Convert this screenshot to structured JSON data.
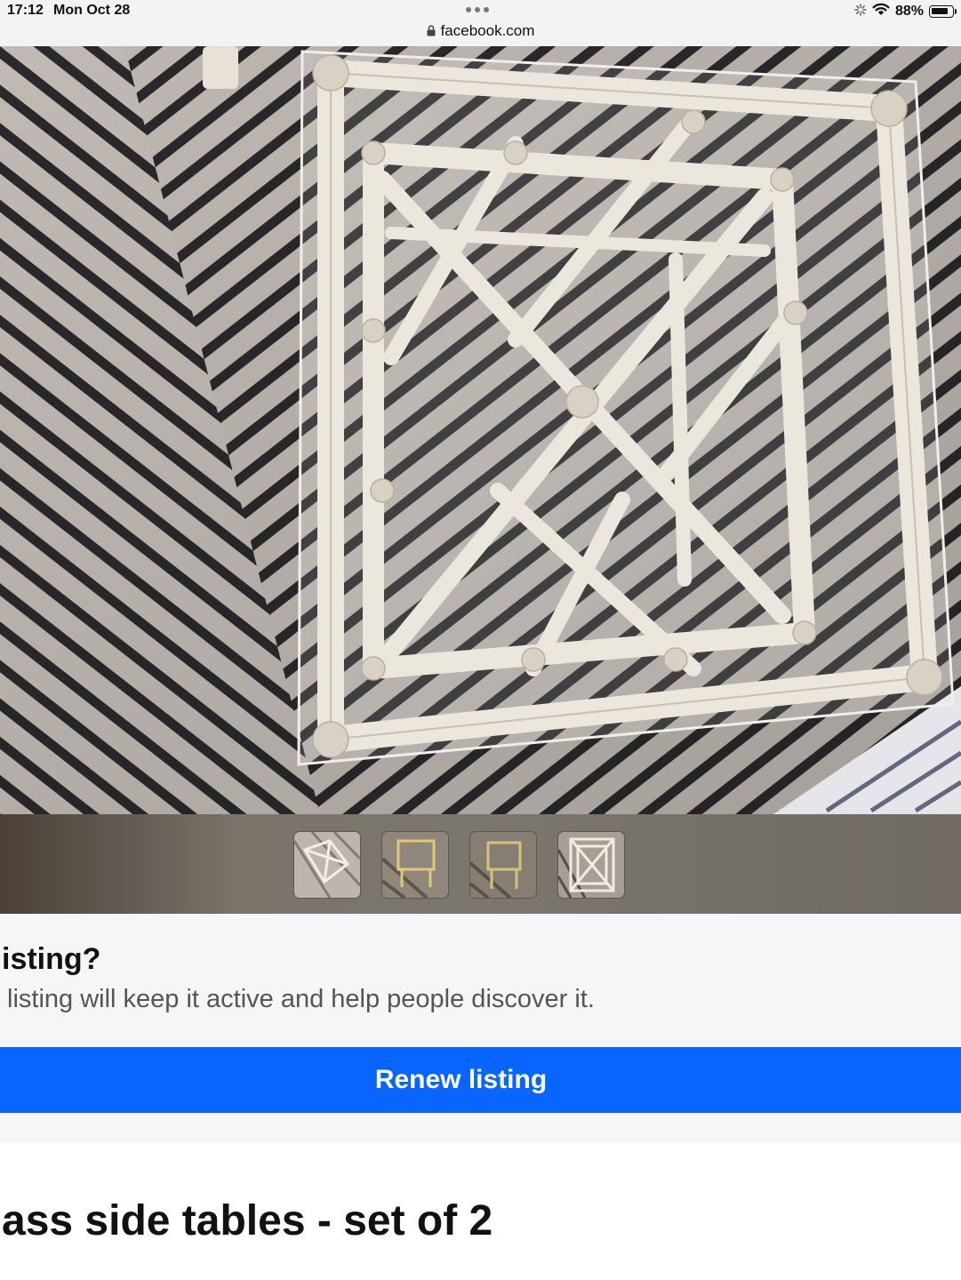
{
  "status_bar": {
    "time": "17:12",
    "date": "Mon Oct 28",
    "url": "facebook.com",
    "battery": "88%",
    "battery_level": 0.88,
    "icons": [
      "lock-icon",
      "activity-spinner-icon",
      "wifi-icon",
      "battery-icon"
    ]
  },
  "gallery": {
    "thumbnail_count": 4,
    "thumbnails": [
      "thumbnail-1",
      "thumbnail-2",
      "thumbnail-3",
      "thumbnail-4"
    ]
  },
  "renew": {
    "heading": "isting?",
    "description": " listing will keep it active and help people discover it.",
    "button_label": "Renew listing"
  },
  "listing": {
    "title": "ass side tables - set of 2"
  },
  "colors": {
    "primary_button": "#0866ff",
    "panel_background": "#f5f6f7"
  }
}
